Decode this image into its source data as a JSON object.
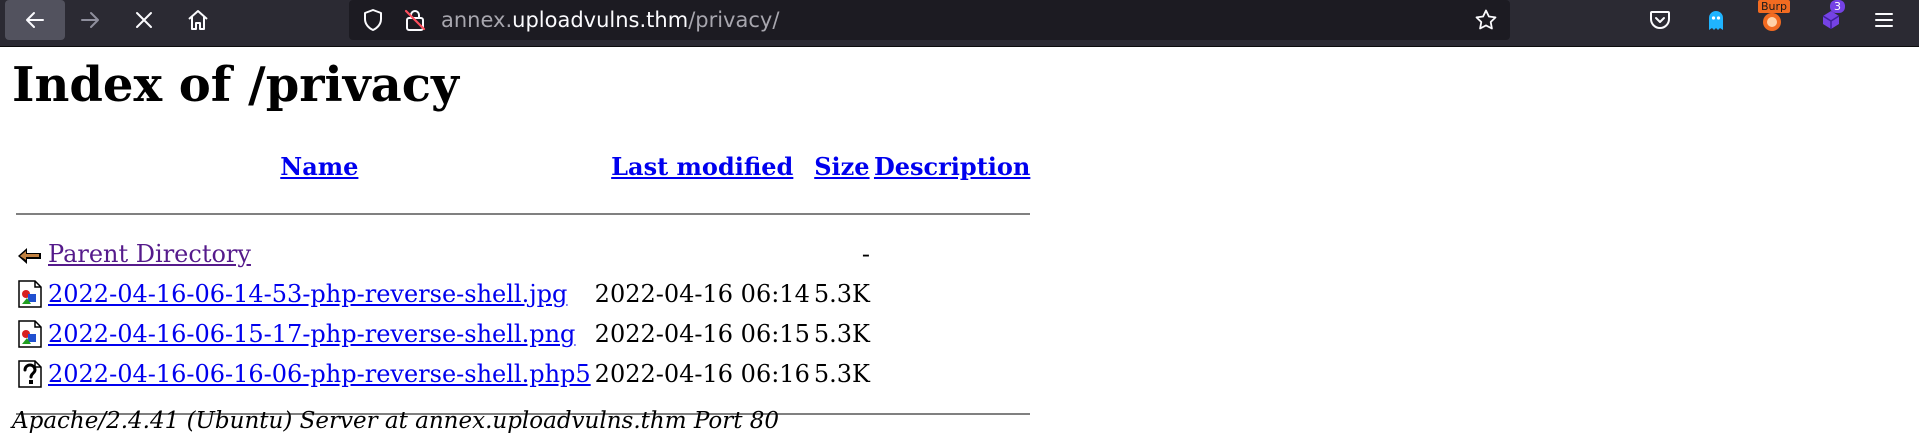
{
  "browser": {
    "url": {
      "prefix": "annex.",
      "domain": "uploadvulns.thm",
      "path": "/privacy/"
    },
    "extensions": {
      "burp_label": "Burp",
      "badge_count": "3"
    },
    "colors": {
      "toolbar": "#2b2a33",
      "urlbar": "#1c1b22",
      "burp": "#f26b21",
      "badge": "#7542e5",
      "ghost": "#1fb4ff"
    }
  },
  "page": {
    "title": "Index of /privacy",
    "columns": {
      "name": "Name",
      "last_modified": "Last modified",
      "size": "Size",
      "description": "Description"
    },
    "parent": {
      "name": "Parent Directory",
      "size": "-",
      "icon": "back-arrow-icon"
    },
    "files": [
      {
        "name": "2022-04-16-06-14-53-php-reverse-shell.jpg",
        "modified": "2022-04-16 06:14",
        "size": "5.3K",
        "icon": "image-file-icon"
      },
      {
        "name": "2022-04-16-06-15-17-php-reverse-shell.png",
        "modified": "2022-04-16 06:15",
        "size": "5.3K",
        "icon": "image-file-icon"
      },
      {
        "name": "2022-04-16-06-16-06-php-reverse-shell.php5",
        "modified": "2022-04-16 06:16",
        "size": "5.3K",
        "icon": "unknown-file-icon"
      }
    ],
    "address": "Apache/2.4.41 (Ubuntu) Server at annex.uploadvulns.thm Port 80"
  }
}
